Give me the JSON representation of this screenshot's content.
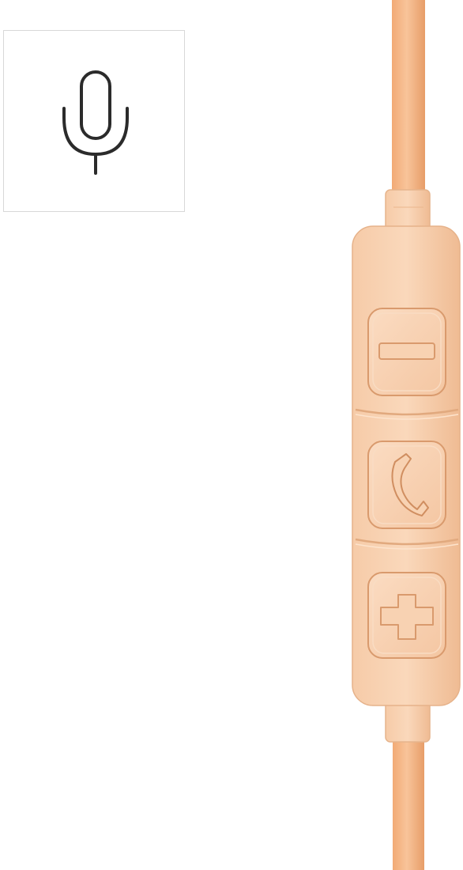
{
  "feature_badge": {
    "icon": "microphone-icon"
  },
  "product": {
    "name_icon": "inline-remote-control",
    "color": "#f6c49d",
    "buttons": [
      {
        "icon": "volume-down-icon"
      },
      {
        "icon": "phone-call-icon"
      },
      {
        "icon": "volume-up-icon"
      }
    ]
  }
}
